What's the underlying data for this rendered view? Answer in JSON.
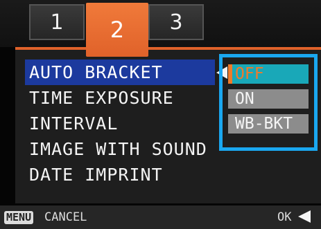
{
  "tabs": [
    {
      "label": "1"
    },
    {
      "label": "2"
    },
    {
      "label": "3"
    }
  ],
  "menu": {
    "items": [
      {
        "label": "AUTO BRACKET"
      },
      {
        "label": "TIME EXPOSURE"
      },
      {
        "label": "INTERVAL"
      },
      {
        "label": "IMAGE WITH SOUND"
      },
      {
        "label": "DATE IMPRINT"
      }
    ],
    "selected_index": 0
  },
  "options": {
    "items": [
      {
        "label": "OFF"
      },
      {
        "label": "ON"
      },
      {
        "label": "WB-BKT"
      }
    ],
    "selected_index": 0
  },
  "bottom": {
    "menu_key": "MENU",
    "cancel": "CANCEL",
    "ok": "OK"
  },
  "colors": {
    "active_tab": "#e0622a",
    "selection": "#1c3a9e",
    "options_border": "#1aa7f0",
    "active_option": "#19a8b8",
    "inactive_option": "#8c8c8c"
  }
}
